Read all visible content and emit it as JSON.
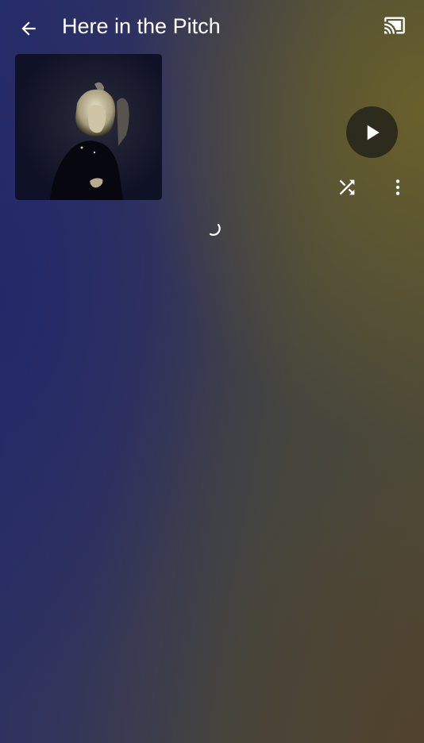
{
  "header": {
    "title": "Here in the Pitch",
    "back_icon": "arrow-back-icon",
    "cast_icon": "cast-icon"
  },
  "album": {
    "art_icon": "album-cover-image"
  },
  "actions": {
    "play_icon": "play-icon",
    "shuffle_icon": "shuffle-icon",
    "more_icon": "more-vertical-icon"
  },
  "status": {
    "loading_icon": "loading-spinner-icon"
  },
  "colors": {
    "text": "#ffffff",
    "play_button_bg": "#28261c",
    "background_left": "#262d6a",
    "background_right": "#4f4a34"
  }
}
